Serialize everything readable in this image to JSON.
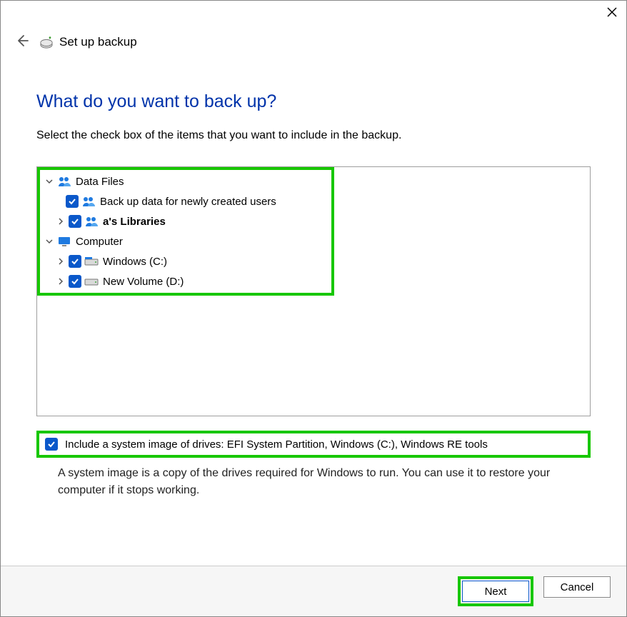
{
  "window": {
    "title": "Set up backup"
  },
  "page": {
    "heading": "What do you want to back up?",
    "subtext": "Select the check box of the items that you want to include in the backup."
  },
  "tree": {
    "data_files": {
      "label": "Data Files",
      "items": [
        {
          "label": "Back up data for newly created users",
          "checked": true
        },
        {
          "label": "a's Libraries",
          "checked": true,
          "bold": true,
          "expandable": true
        }
      ]
    },
    "computer": {
      "label": "Computer",
      "items": [
        {
          "label": "Windows (C:)",
          "checked": true,
          "expandable": true
        },
        {
          "label": "New Volume (D:)",
          "checked": true,
          "expandable": true
        }
      ]
    }
  },
  "system_image": {
    "checked": true,
    "label": "Include a system image of drives: EFI System Partition, Windows (C:), Windows RE tools",
    "description": "A system image is a copy of the drives required for Windows to run. You can use it to restore your computer if it stops working."
  },
  "buttons": {
    "next": "Next",
    "cancel": "Cancel"
  }
}
